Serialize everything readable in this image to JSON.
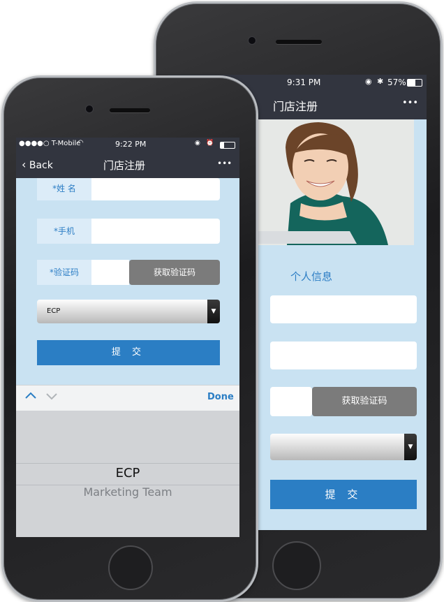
{
  "back_phone": {
    "status_bar": {
      "time": "9:31 PM",
      "battery": "57%"
    },
    "nav": {
      "title": "门店注册",
      "more": "•••"
    },
    "section_title": "个人信息",
    "get_code_label": "获取验证码",
    "submit_label": "提 交"
  },
  "front_phone": {
    "status_bar": {
      "carrier": "●●●●○ T-Mobile",
      "time": "9:22 PM"
    },
    "nav": {
      "back_label": "Back",
      "title": "门店注册",
      "more": "•••"
    },
    "form": {
      "name_label": "*姓 名",
      "phone_label": "*手机",
      "code_label": "*验证码",
      "get_code_label": "获取验证码",
      "store_select_value": "ECP",
      "submit_label": "提 交"
    },
    "keyboard_toolbar": {
      "prev": "∧",
      "next": "∨",
      "done_label": "Done"
    },
    "picker": {
      "selected": "ECP",
      "next_option": "Marketing Team"
    }
  },
  "colors": {
    "nav_bg": "#32353f",
    "page_bg": "#c9e2f2",
    "accent_blue": "#2b7ec4",
    "button_gray": "#7b7b7b"
  }
}
